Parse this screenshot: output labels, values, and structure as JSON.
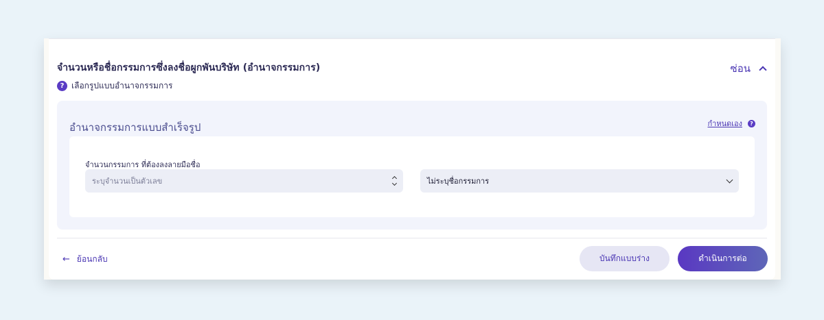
{
  "section": {
    "title": "จำนวนหรือชื่อกรรมการซึ่งลงชื่อผูกพันบริษัท (อำนาจกรรมการ)",
    "toggle_label": "ซ่อน",
    "help_icon_symbol": "?",
    "help_text": "เลือกรูปแบบอำนาจกรรมการ"
  },
  "panel": {
    "title": "อำนาจกรรมการแบบสำเร็จรูป",
    "custom_link": "กำหนดเอง",
    "custom_help_symbol": "?",
    "field_label": "จำนวนกรรมการ ที่ต้องลงลายมือชื่อ",
    "number_input": {
      "placeholder": "ระบุจำนวนเป็นตัวเลข",
      "value": ""
    },
    "select": {
      "selected": "ไม่ระบุชื่อกรรมการ"
    }
  },
  "footer": {
    "back_icon": "←",
    "back_label": "ย้อนกลับ",
    "draft_label": "บันทึกแบบร่าง",
    "next_label": "ดำเนินการต่อ"
  },
  "colors": {
    "accent": "#4a36b3",
    "primary_button": "#5a38c2",
    "background": "#eaf3f9"
  }
}
